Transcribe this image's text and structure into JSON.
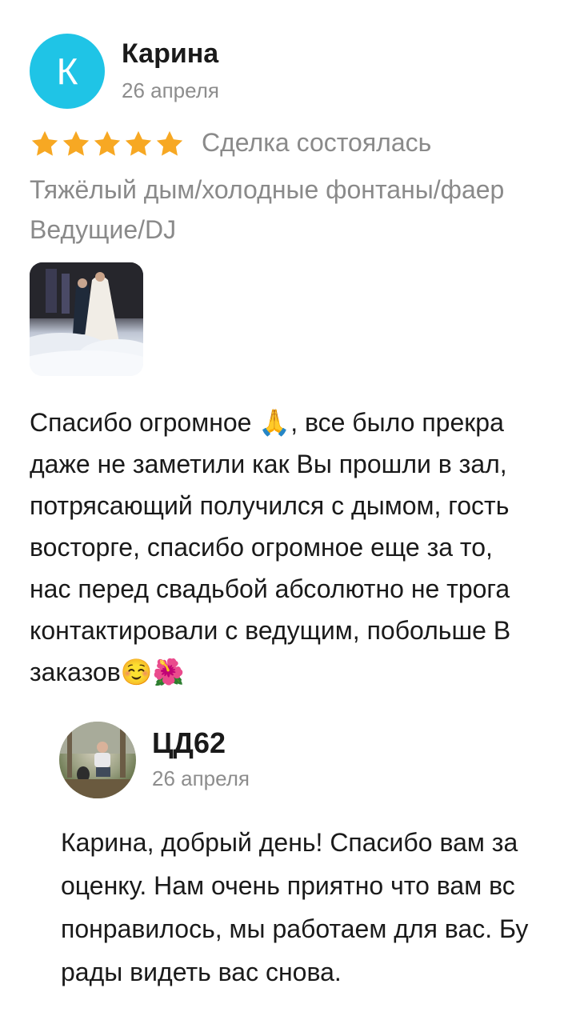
{
  "review": {
    "avatar_letter": "К",
    "author": "Карина",
    "date": "26 апреля",
    "rating": 5,
    "rating_max": 5,
    "deal_status": "Сделка состоялась",
    "services_line1": "Тяжёлый дым/холодные фонтаны/фаер",
    "services_line2": "Ведущие/DJ",
    "text_lines": [
      "Спасибо огромное 🙏, все было прекра",
      "даже не заметили как Вы прошли в зал, ",
      "потрясающий получился с дымом, гость",
      "восторге, спасибо огромное еще за то, ",
      "нас перед свадьбой абсолютно не трога",
      "контактировали с ведущим, побольше В",
      "заказов☺️🌺"
    ]
  },
  "reply": {
    "author": "ЦД62",
    "date": "26 апреля",
    "text_lines": [
      "Карина, добрый день! Спасибо вам за",
      "оценку. Нам очень приятно что вам вс",
      "понравилось, мы работаем для вас. Бу",
      "рады видеть вас снова."
    ]
  },
  "colors": {
    "star": "#f7a823",
    "avatar_bg": "#1fc4e6",
    "secondary_text": "#8a8a8a"
  }
}
